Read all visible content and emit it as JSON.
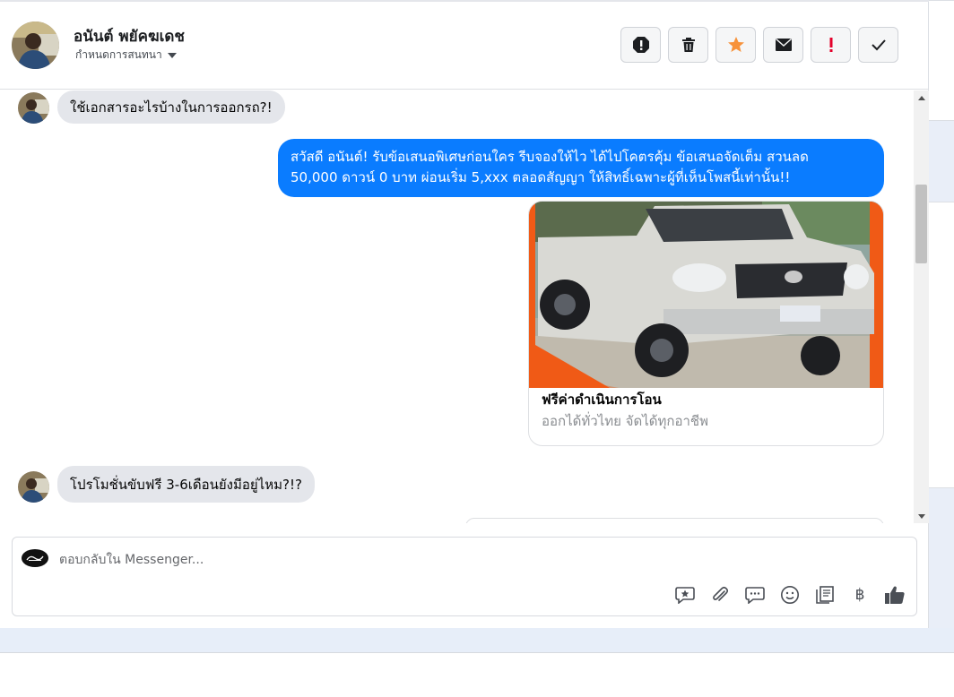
{
  "contact": {
    "name": "อนันต์ พยัคฆเดช",
    "assign_label": "กำหนดการสนทนา"
  },
  "header_actions": [
    {
      "icon": "alert-circle-icon"
    },
    {
      "icon": "trash-icon"
    },
    {
      "icon": "star-icon",
      "color": "#f7923a"
    },
    {
      "icon": "envelope-icon"
    },
    {
      "icon": "exclamation-icon",
      "color": "#e4002b"
    },
    {
      "icon": "check-icon"
    }
  ],
  "messages": [
    {
      "direction": "incoming",
      "text": "ใช้เอกสารอะไรบ้างในการออกรถ?!"
    },
    {
      "direction": "outgoing",
      "lines": [
        "สวัสดี อนันต์! รับข้อเสนอพิเศษก่อนใคร รีบจองให้ไว ได้ไปโคตรคุ้ม ข้อเสนอจัดเต็ม สวนลด",
        "50,000 ดาวน์ 0 บาท ผ่อนเริ่ม 5,xxx ตลอดสัญญา ให้สิทธิ์เฉพาะผู้ที่เห็นโพสนี้เท่านั้น!!"
      ]
    },
    {
      "direction": "outgoing-card",
      "title": "ฟรีค่าดำเนินการโอน",
      "subtitle": "ออกได้ทั่วไทย จัดได้ทุกอาชีพ"
    },
    {
      "direction": "incoming",
      "text": "โปรโมชั่นขับฟรี 3-6เดือนยังมีอยู่ไหม?!?"
    }
  ],
  "composer": {
    "placeholder": "ตอบกลับใน Messenger...",
    "tools": [
      "saved-reply-icon",
      "paperclip-icon",
      "chat-bubble-icon",
      "smiley-icon",
      "receipt-icon",
      "baht-icon",
      "thumbs-up-icon"
    ],
    "baht_symbol": "฿"
  },
  "colors": {
    "outgoing_bubble": "#0a7cff",
    "incoming_bubble": "#e4e6eb"
  }
}
